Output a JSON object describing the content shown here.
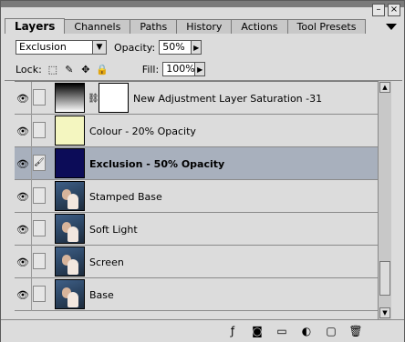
{
  "tabs": [
    "Layers",
    "Channels",
    "Paths",
    "History",
    "Actions",
    "Tool Presets"
  ],
  "blend_mode": "Exclusion",
  "opacity_label": "Opacity:",
  "opacity_value": "50%",
  "lock_label": "Lock:",
  "fill_label": "Fill:",
  "fill_value": "100%",
  "layers": [
    {
      "name": "New Adjustment Layer Saturation -31"
    },
    {
      "name": "Colour - 20% Opacity"
    },
    {
      "name": "Exclusion - 50% Opacity"
    },
    {
      "name": "Stamped Base"
    },
    {
      "name": "Soft Light"
    },
    {
      "name": "Screen"
    },
    {
      "name": "Base"
    }
  ],
  "colors": {
    "selected_row": "#a8b0bd",
    "colour_fill": "#f4f6c0",
    "exclusion_fill": "#0c0c58"
  }
}
